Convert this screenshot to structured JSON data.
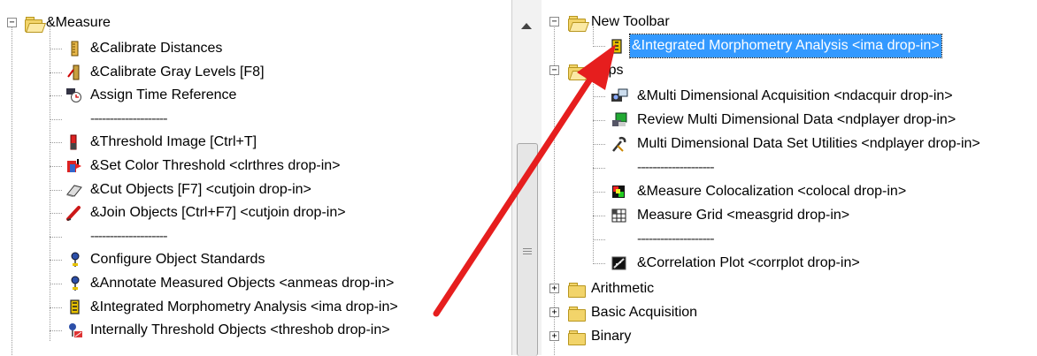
{
  "left_tree": {
    "root_label": "&Measure",
    "items": [
      {
        "label": "&Calibrate Distances",
        "icon": "ruler-calibrate-icon"
      },
      {
        "label": "&Calibrate Gray Levels    [F8]",
        "icon": "gray-calibrate-icon"
      },
      {
        "label": "Assign Time Reference",
        "icon": "clock-reference-icon"
      },
      {
        "label": "--------------------",
        "icon": ""
      },
      {
        "label": "&Threshold Image    [Ctrl+T]",
        "icon": "threshold-icon"
      },
      {
        "label": "&Set Color Threshold  <clrthres drop-in>",
        "icon": "color-threshold-icon"
      },
      {
        "label": "&Cut Objects    [F7]  <cutjoin drop-in>",
        "icon": "eraser-icon"
      },
      {
        "label": "&Join Objects    [Ctrl+F7]  <cutjoin drop-in>",
        "icon": "pencil-icon"
      },
      {
        "label": "--------------------",
        "icon": ""
      },
      {
        "label": "Configure Object Standards",
        "icon": "pushpin-icon"
      },
      {
        "label": "&Annotate Measured Objects  <anmeas drop-in>",
        "icon": "pushpin-icon"
      },
      {
        "label": "&Integrated Morphometry Analysis  <ima drop-in>",
        "icon": "morphometry-icon"
      },
      {
        "label": "Internally Threshold Objects  <threshob drop-in>",
        "icon": "threshold-objects-icon"
      }
    ]
  },
  "right_tree": {
    "new_toolbar": {
      "label": "New Toolbar",
      "child": "&Integrated Morphometry Analysis  <ima drop-in>"
    },
    "apps": {
      "label": "Apps",
      "items": [
        {
          "label": "&Multi Dimensional Acquisition  <ndacquir drop-in>",
          "icon": "camera-acquisition-icon"
        },
        {
          "label": "Review Multi Dimensional Data  <ndplayer drop-in>",
          "icon": "viewer-icon"
        },
        {
          "label": "Multi Dimensional Data Set Utilities  <ndplayer drop-in>",
          "icon": "tools-icon"
        },
        {
          "label": "--------------------",
          "icon": ""
        },
        {
          "label": "&Measure Colocalization  <colocal drop-in>",
          "icon": "colocalization-icon"
        },
        {
          "label": "Measure Grid  <measgrid drop-in>",
          "icon": "grid-icon"
        },
        {
          "label": "--------------------",
          "icon": ""
        },
        {
          "label": "&Correlation Plot  <corrplot drop-in>",
          "icon": "correlation-plot-icon"
        }
      ]
    },
    "folders": [
      "Arithmetic",
      "Basic Acquisition",
      "Binary"
    ]
  },
  "colors": {
    "selection": "#3399ff",
    "arrow": "#e61e1e",
    "folder": "#f2d46a"
  }
}
